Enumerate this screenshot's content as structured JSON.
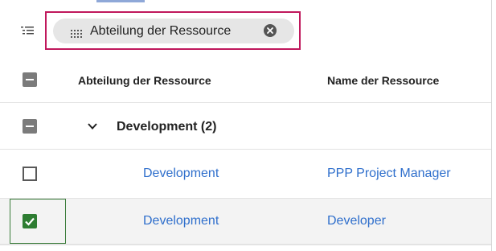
{
  "group_panel": {
    "chip_label": "Abteilung der Ressource"
  },
  "grid": {
    "columns": [
      "Abteilung der Ressource",
      "Name der Ressource"
    ],
    "group": {
      "label": "Development (2)"
    },
    "rows": [
      {
        "department": "Development",
        "name": "PPP Project Manager",
        "selected": false
      },
      {
        "department": "Development",
        "name": "Developer",
        "selected": true
      }
    ]
  },
  "colors": {
    "highlight": "#c0185c",
    "link": "#2f6fcc",
    "checked": "#2e7d32"
  }
}
